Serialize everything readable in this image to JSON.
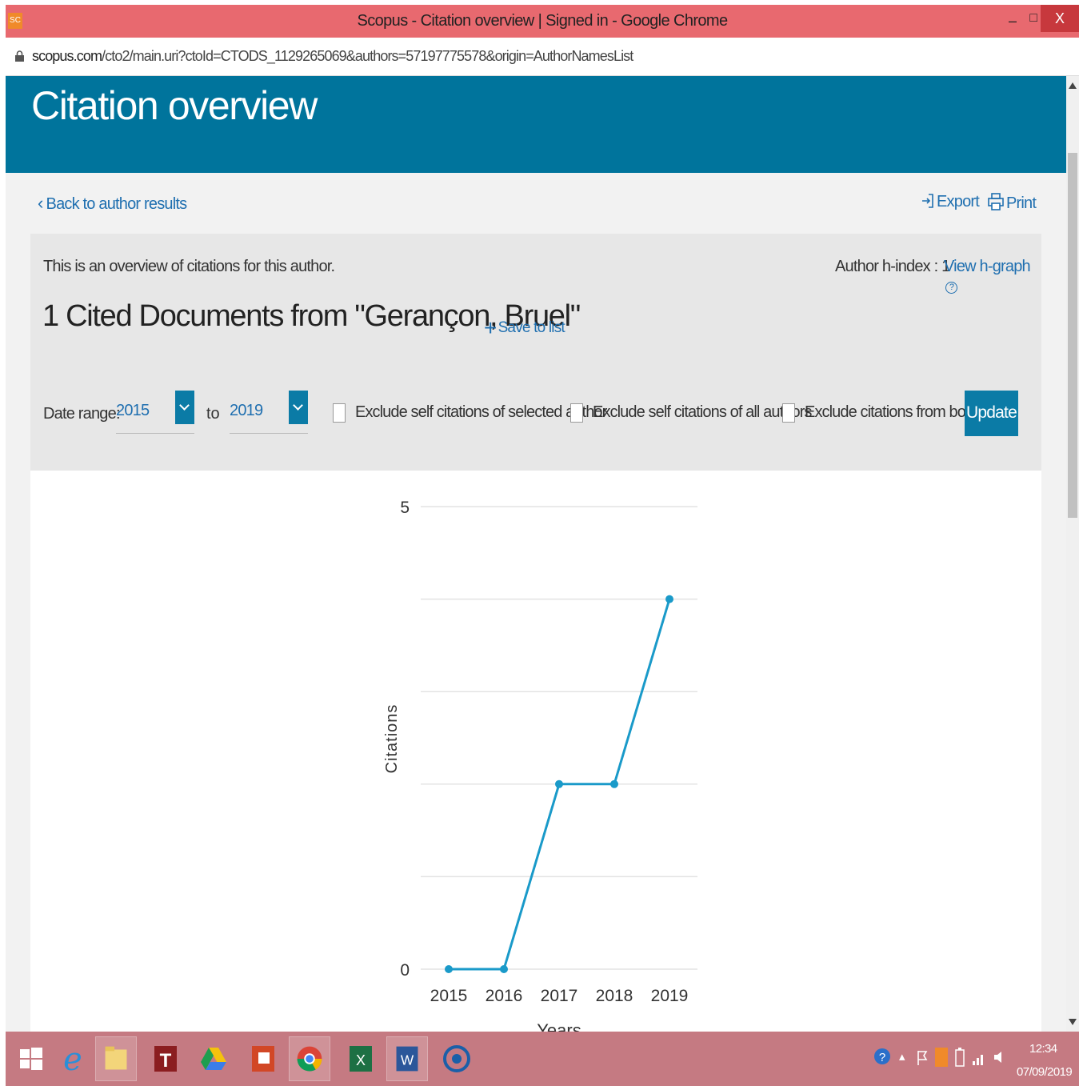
{
  "window": {
    "title": "Scopus - Citation overview | Signed in - Google Chrome",
    "app_icon_label": "SC",
    "minimize_label": "–",
    "maximize_label": "□",
    "close_label": "X"
  },
  "address_bar": {
    "domain": "scopus.com",
    "path": "/cto2/main.uri?ctoId=CTODS_1129265069&authors=57197775578&origin=AuthorNamesList"
  },
  "page": {
    "banner_title": "Citation overview",
    "back_link": "Back to author results",
    "export_label": "Export",
    "print_label": "Print"
  },
  "overview": {
    "description": "This is an overview of citations for this author.",
    "hindex_label": "Author h-index : 1",
    "hgraph_label": "View h-graph",
    "heading": "1 Cited Documents from  \"Gerançon, Bruel\"",
    "save_label": "Save to list"
  },
  "filters": {
    "date_range_label": "Date range:",
    "from_value": "2015",
    "to_label": "to",
    "to_value": "2019",
    "exclude_selected_author": "Exclude self citations of selected author",
    "exclude_all_authors": "Exclude self citations of all authors",
    "exclude_books": "Exclude citations from books",
    "update_label": "Update",
    "exclude_selected_author_checked": false,
    "exclude_all_authors_checked": false,
    "exclude_books_checked": false
  },
  "chart_data": {
    "type": "line",
    "categories": [
      "2015",
      "2016",
      "2017",
      "2018",
      "2019"
    ],
    "series": [
      {
        "values": [
          0,
          0,
          2,
          2,
          4
        ]
      }
    ],
    "xlabel": "Years",
    "ylabel": "Citations",
    "ylim": [
      0,
      5
    ],
    "y_tick_labels": [
      "0",
      "5"
    ],
    "grid": true,
    "color": "#1a9ac9"
  },
  "taskbar": {
    "time": "12:34",
    "date": "07/09/2019",
    "accent": "#c57a82"
  }
}
